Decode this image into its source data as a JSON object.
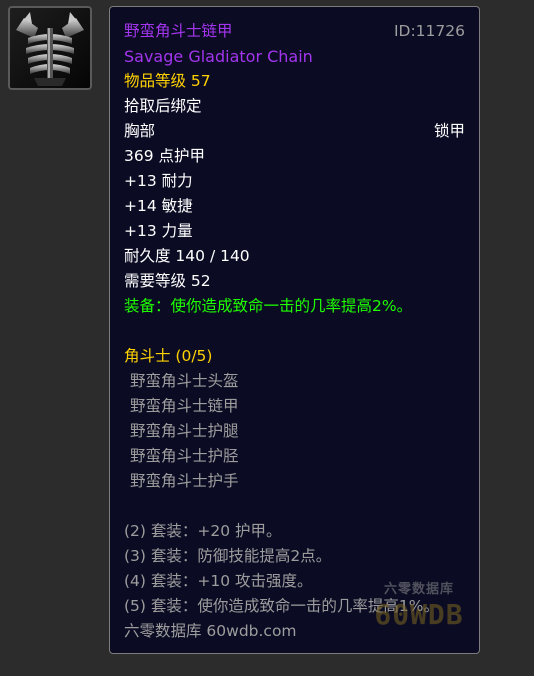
{
  "item": {
    "icon": "chest-armor-icon",
    "name_cn": "野蛮角斗士链甲",
    "name_en": "Savage Gladiator Chain",
    "id_label": "ID:11726",
    "item_level": "物品等级 57",
    "binding": "拾取后绑定",
    "slot": "胸部",
    "armor_type": "锁甲",
    "armor": "369 点护甲",
    "stats": [
      "+13 耐力",
      "+14 敏捷",
      "+13 力量"
    ],
    "durability": "耐久度 140 / 140",
    "required_level": "需要等级 52",
    "equip_effect": "装备：使你造成致命一击的几率提高2%。"
  },
  "set": {
    "name": "角斗士 (0/5)",
    "pieces": [
      "野蛮角斗士头盔",
      "野蛮角斗士链甲",
      "野蛮角斗士护腿",
      "野蛮角斗士护胫",
      "野蛮角斗士护手"
    ],
    "bonuses": [
      "(2) 套装：+20 护甲。",
      "(3) 套装：防御技能提高2点。",
      "(4) 套装：+10 攻击强度。",
      "(5) 套装：使你造成致命一击的几率提高1%。"
    ]
  },
  "footer": "六零数据库 60wdb.com",
  "watermark": {
    "top": "六零数据库",
    "big": "60WDB"
  },
  "colors": {
    "epic": "#a335ee",
    "set_name": "#ffd100",
    "equip": "#1eff00",
    "inactive": "#9d9d9d",
    "background": "#0b0c24"
  }
}
